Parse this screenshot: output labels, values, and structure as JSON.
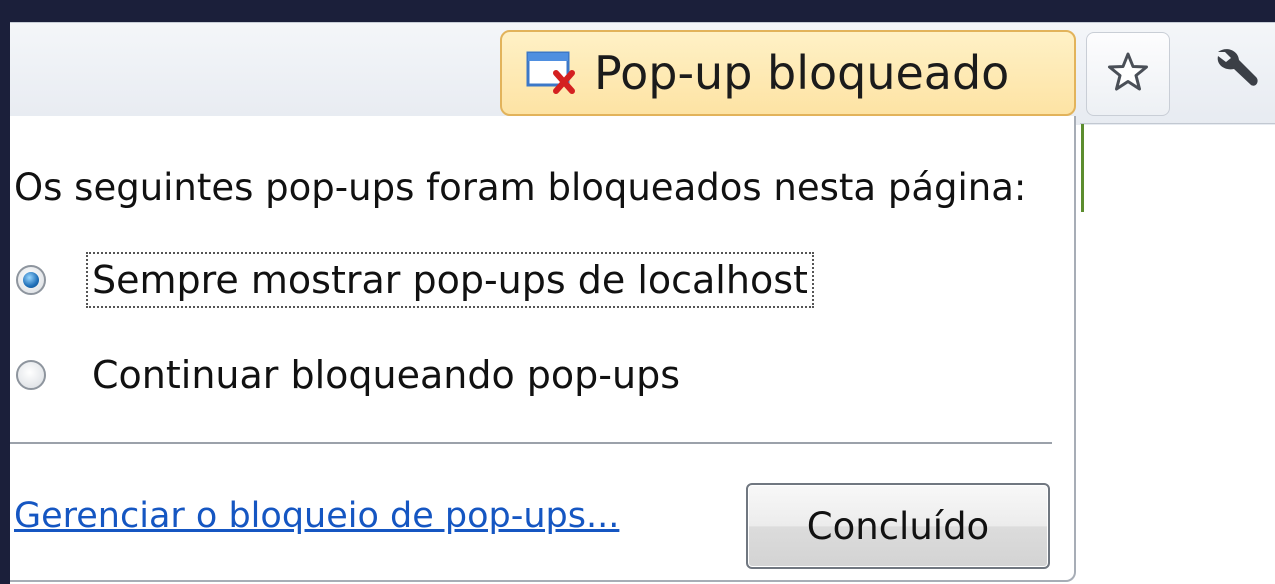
{
  "toolbar": {
    "popup_chip_label": "Pop-up bloqueado",
    "popup_chip_icon": "blocked-window-icon",
    "star_icon": "star-icon",
    "wrench_icon": "wrench-icon"
  },
  "bubble": {
    "title": "Os seguintes pop-ups foram bloqueados nesta página:",
    "options": [
      {
        "label": "Sempre mostrar pop-ups de localhost",
        "selected": true
      },
      {
        "label": "Continuar bloqueando pop-ups",
        "selected": false
      }
    ],
    "manage_link": "Gerenciar o bloqueio de pop-ups...",
    "done_button": "Concluído"
  },
  "colors": {
    "chip_background": "#fde3a4",
    "chip_border": "#e2b35b",
    "link": "#1556c2",
    "frame_background": "#1b1f3a"
  }
}
